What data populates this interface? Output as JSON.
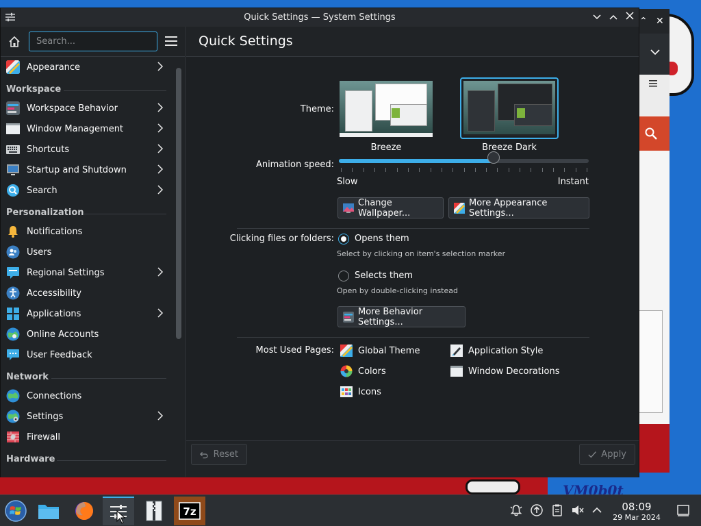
{
  "window": {
    "title": "Quick Settings — System Settings"
  },
  "sidebar": {
    "search_placeholder": "Search...",
    "items": [
      {
        "label": "Appearance"
      },
      {
        "section": "Workspace"
      },
      {
        "label": "Workspace Behavior"
      },
      {
        "label": "Window Management"
      },
      {
        "label": "Shortcuts"
      },
      {
        "label": "Startup and Shutdown"
      },
      {
        "label": "Search"
      },
      {
        "section": "Personalization"
      },
      {
        "label": "Notifications"
      },
      {
        "label": "Users"
      },
      {
        "label": "Regional Settings"
      },
      {
        "label": "Accessibility"
      },
      {
        "label": "Applications"
      },
      {
        "label": "Online Accounts"
      },
      {
        "label": "User Feedback"
      },
      {
        "section": "Network"
      },
      {
        "label": "Connections"
      },
      {
        "label": "Settings"
      },
      {
        "label": "Firewall"
      },
      {
        "section": "Hardware"
      }
    ]
  },
  "main": {
    "page_title": "Quick Settings",
    "theme": {
      "label": "Theme:",
      "options": [
        {
          "name": "Breeze",
          "selected": false
        },
        {
          "name": "Breeze Dark",
          "selected": true
        }
      ]
    },
    "animation": {
      "label": "Animation speed:",
      "min_label": "Slow",
      "max_label": "Instant",
      "value_fraction": 0.62
    },
    "buttons": {
      "change_wallpaper": "Change Wallpaper...",
      "more_appearance": "More Appearance Settings...",
      "more_behavior": "More Behavior Settings..."
    },
    "clicking": {
      "label": "Clicking files or folders:",
      "opens_label": "Opens them",
      "opens_hint": "Select by clicking on item's selection marker",
      "selects_label": "Selects them",
      "selects_hint": "Open by double-clicking instead",
      "selected": "opens"
    },
    "most_used": {
      "label": "Most Used Pages:",
      "items": [
        "Global Theme",
        "Application Style",
        "Colors",
        "Window Decorations",
        "Icons"
      ]
    },
    "footer": {
      "reset_label": "Reset",
      "apply_label": "Apply"
    }
  },
  "background_text": {
    "watermark": "VM0b0t"
  },
  "taskbar": {
    "time": "08:09",
    "date": "29 Mar 2024"
  },
  "colors": {
    "accent": "#3daee9",
    "window_bg": "#202326",
    "panel_bg": "#2b2f33"
  }
}
